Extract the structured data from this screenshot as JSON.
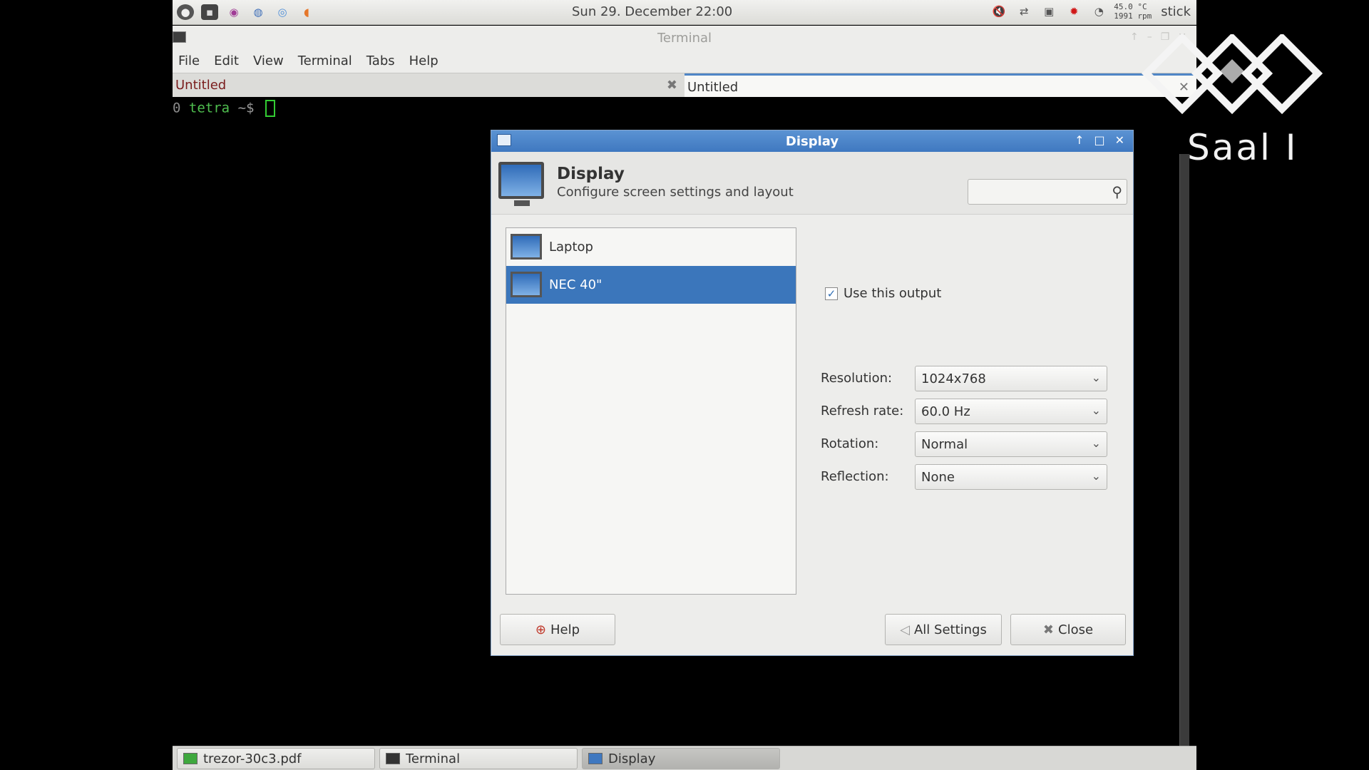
{
  "panel": {
    "clock": "Sun 29. December 22:00",
    "sensors_temp": "45.0 °C",
    "sensors_rpm": "1991 rpm",
    "user": "stick"
  },
  "terminal": {
    "title": "Terminal",
    "menu": [
      "File",
      "Edit",
      "View",
      "Terminal",
      "Tabs",
      "Help"
    ],
    "tabs": [
      {
        "label": "Untitled",
        "state": "inactive"
      },
      {
        "label": "Untitled",
        "state": "active"
      }
    ],
    "prompt": {
      "prefix": "0",
      "host": "tetra",
      "dir": "~$"
    }
  },
  "logo": {
    "text": "Saal I"
  },
  "dialog": {
    "title": "Display",
    "header_title": "Display",
    "header_subtitle": "Configure screen settings and layout",
    "search_placeholder": "",
    "outputs": [
      {
        "label": "Laptop",
        "selected": false
      },
      {
        "label": "NEC 40\"",
        "selected": true
      }
    ],
    "use_output_label": "Use this output",
    "use_output_checked": true,
    "settings": [
      {
        "label": "Resolution:",
        "value": "1024x768"
      },
      {
        "label": "Refresh rate:",
        "value": "60.0 Hz"
      },
      {
        "label": "Rotation:",
        "value": "Normal"
      },
      {
        "label": "Reflection:",
        "value": "None"
      }
    ],
    "buttons": {
      "help": "Help",
      "all_settings": "All Settings",
      "close": "Close"
    }
  },
  "taskbar": [
    {
      "label": "trezor-30c3.pdf",
      "icon": "pdf-icon",
      "active": false
    },
    {
      "label": "Terminal",
      "icon": "terminal-icon",
      "active": false
    },
    {
      "label": "Display",
      "icon": "monitor-icon",
      "active": true
    }
  ],
  "colors": {
    "selection_blue": "#3b76bb",
    "titlebar_blue": "#4a84c9",
    "prompt_green": "#4fbf4f"
  }
}
